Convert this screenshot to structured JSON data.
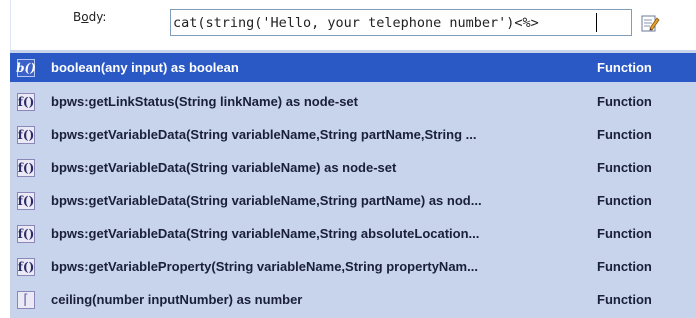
{
  "editor": {
    "field_label_prefix": "B",
    "field_label_underlined": "o",
    "field_label_suffix": "dy:",
    "expression_value": "cat(string('Hello, your telephone number')<%>"
  },
  "suggestions": [
    {
      "icon": "b()",
      "label": "boolean(any input) as boolean",
      "kind": "Function",
      "selected": true
    },
    {
      "icon": "f()",
      "label": "bpws:getLinkStatus(String linkName) as node-set",
      "kind": "Function"
    },
    {
      "icon": "f()",
      "label": "bpws:getVariableData(String variableName,String partName,String ...",
      "kind": "Function"
    },
    {
      "icon": "f()",
      "label": "bpws:getVariableData(String variableName) as node-set",
      "kind": "Function"
    },
    {
      "icon": "f()",
      "label": "bpws:getVariableData(String variableName,String partName) as nod...",
      "kind": "Function"
    },
    {
      "icon": "f()",
      "label": "bpws:getVariableData(String variableName,String absoluteLocation...",
      "kind": "Function"
    },
    {
      "icon": "f()",
      "label": "bpws:getVariableProperty(String variableName,String propertyNam...",
      "kind": "Function"
    },
    {
      "icon": "⌈",
      "label": "ceiling(number inputNumber) as number",
      "kind": "Function"
    }
  ]
}
